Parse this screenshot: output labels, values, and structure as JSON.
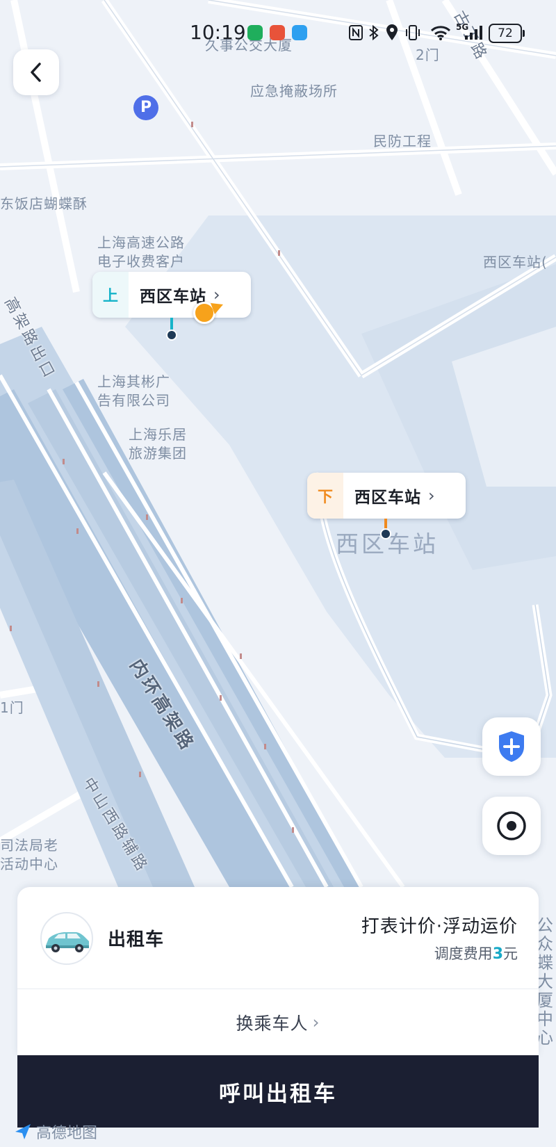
{
  "status_bar": {
    "time": "10:19",
    "network": "5G",
    "battery": "72",
    "icons": [
      "nfc-icon",
      "bluetooth-icon",
      "location-icon",
      "vibrate-icon",
      "wifi-icon",
      "signal-icon"
    ]
  },
  "map": {
    "labels": {
      "building_1": "久事公交大厦",
      "gate_2": "2门",
      "shelter": "应急掩蔽场所",
      "civil_defense": "民防工程",
      "restaurant": "东饭店蝴蝶酥",
      "etc_service": "上海高速公路\n电子收费客户",
      "west_station_right": "西区车站(",
      "elevated_exit": "高架路出口",
      "advertising": "上海其彬广\n告有限公司",
      "travel_group": "上海乐居\n旅游集团",
      "gate_left": "1门",
      "justice_bureau": "司法局老\n活动中心",
      "right_edge": "公众\n蝶\n大厦\n中心"
    },
    "roads": {
      "guyuan": "古丁路",
      "inner_ring": "内环高架路",
      "zhongshan_west": "中山西路辅路"
    },
    "station_name": "西区车站",
    "parking_label": "P",
    "logo": "高德地图"
  },
  "pickup": {
    "tag": "上",
    "name": "西区车站",
    "color": "#16b3c9"
  },
  "dropoff": {
    "tag": "下",
    "name": "西区车站",
    "color": "#f08a1e"
  },
  "chevron": "›",
  "ride": {
    "type": "出租车",
    "pricing_mode": "打表计价·浮动运价",
    "fee_prefix": "调度费用",
    "fee_amount": "3",
    "fee_unit": "元",
    "change_passenger": "换乘车人",
    "call_button": "呼叫出租车"
  },
  "colors": {
    "accent": "#18a9c7",
    "button_dark": "#1b1f32",
    "user_dot": "#f7a21b",
    "shield": "#3d7bf0"
  }
}
